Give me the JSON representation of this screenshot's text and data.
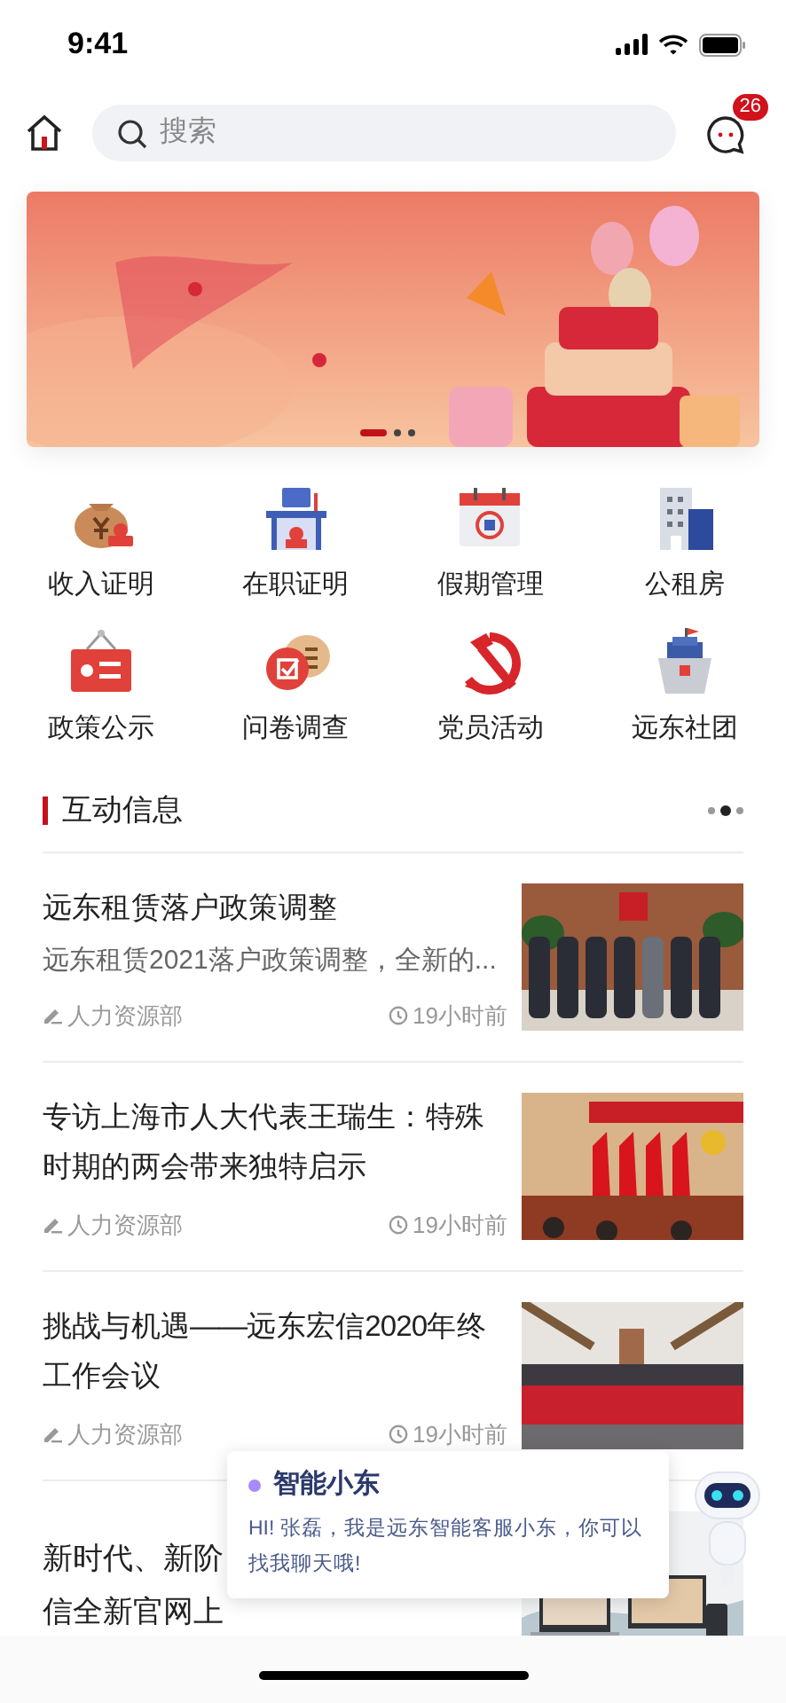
{
  "status_bar": {
    "time": "9:41"
  },
  "header": {
    "search": {
      "placeholder": "搜索"
    },
    "messages_badge": "26"
  },
  "banner": {
    "pager": [
      {
        "selected": true
      },
      {
        "selected": false
      },
      {
        "selected": false
      }
    ]
  },
  "shortcuts": [
    {
      "label": "收入证明"
    },
    {
      "label": "在职证明"
    },
    {
      "label": "假期管理"
    },
    {
      "label": "公租房"
    },
    {
      "label": "政策公示"
    },
    {
      "label": "问卷调查"
    },
    {
      "label": "党员活动"
    },
    {
      "label": "远东社团"
    }
  ],
  "section": {
    "title": "互动信息",
    "pager": [
      {
        "selected": false
      },
      {
        "selected": true
      },
      {
        "selected": false
      }
    ]
  },
  "articles": [
    {
      "title": "远东租赁落户政策调整",
      "summary": "远东租赁2021落户政策调整，全新的...",
      "author": "人力资源部",
      "time": "19小时前"
    },
    {
      "title": "专访上海市人大代表王瑞生：特殊时期的两会带来独特启示",
      "author": "人力资源部",
      "time": "19小时前"
    },
    {
      "title": "挑战与机遇——远东宏信2020年终工作会议",
      "author": "人力资源部",
      "time": "19小时前"
    },
    {
      "title_lines": [
        "新时代、新阶",
        "信全新官网上"
      ]
    }
  ],
  "assistant": {
    "name": "智能小东",
    "message": "HI! 张磊，我是远东智能客服小东，你可以找我聊天哦!"
  }
}
